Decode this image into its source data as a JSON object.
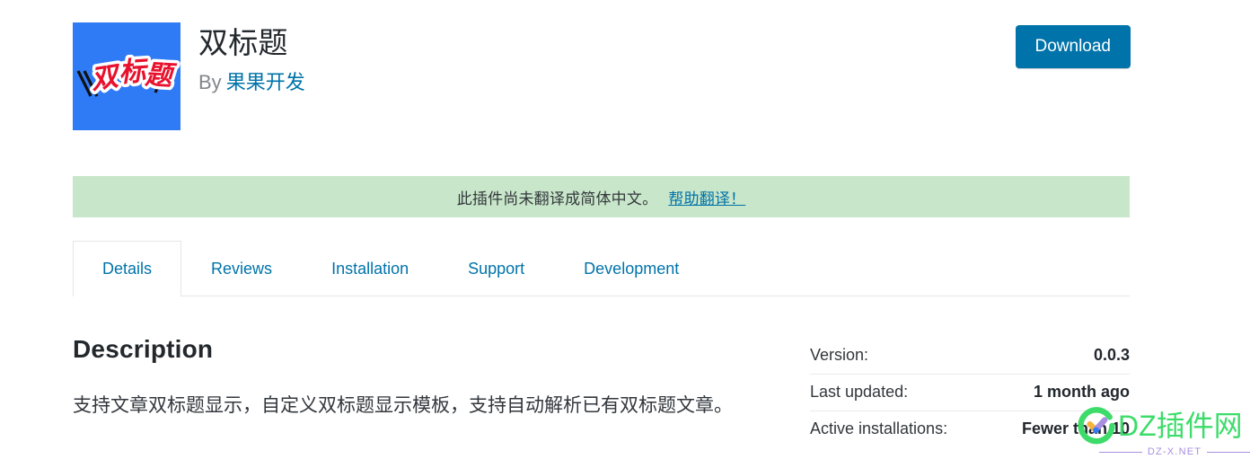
{
  "header": {
    "plugin_title": "双标题",
    "by_label": "By",
    "author": "果果开发",
    "download_label": "Download",
    "icon_text": "双标题",
    "icon_bg_color": "#2f7bf6",
    "icon_text_color": "#e8112d",
    "download_bg_color": "#0073aa",
    "link_color": "#0073aa"
  },
  "notice": {
    "message": "此插件尚未翻译成简体中文。",
    "link_label": "帮助翻译！",
    "bg_color": "#c8e6c9"
  },
  "tabs": [
    {
      "label": "Details",
      "active": true
    },
    {
      "label": "Reviews",
      "active": false
    },
    {
      "label": "Installation",
      "active": false
    },
    {
      "label": "Support",
      "active": false
    },
    {
      "label": "Development",
      "active": false
    }
  ],
  "description": {
    "heading": "Description",
    "body": "支持文章双标题显示，自定义双标题显示模板，支持自动解析已有双标题文章。"
  },
  "meta": [
    {
      "label": "Version:",
      "value": "0.0.3"
    },
    {
      "label": "Last updated:",
      "value": "1 month ago"
    },
    {
      "label": "Active installations:",
      "value": "Fewer than 10"
    }
  ],
  "watermark": {
    "name": "DZ插件网",
    "domain": "DZ-X.NET",
    "name_color": "#3ddc6a",
    "domain_color": "#a98fe0"
  }
}
